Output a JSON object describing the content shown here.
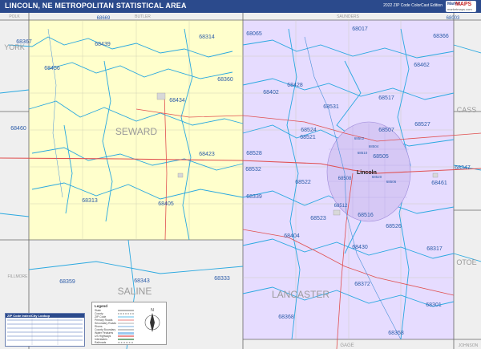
{
  "title": "LINCOLN, NE METROPOLITAN STATISTICAL AREA",
  "edition": "2022 ZIP Code ColorCast Edition",
  "logo": {
    "line1": "Market",
    "line2": "MAPS",
    "line3": "marketmaps.com"
  },
  "colors": {
    "title_bar": "#2b4a8c",
    "seward_fill": "#ffffcc",
    "lancaster_fill": "#e6dcff",
    "outside_fill": "#efefef",
    "zip_boundary": "#2aa8e0",
    "zip_label": "#2b5ba8",
    "county_label": "#9a9a9a",
    "highway": "#e05050"
  },
  "counties": [
    {
      "name": "SEWARD",
      "label": "SEWARD"
    },
    {
      "name": "LANCASTER",
      "label": "LANCASTER"
    },
    {
      "name": "SALINE",
      "label": "SALINE"
    },
    {
      "name": "YORK",
      "label": "YORK"
    },
    {
      "name": "CASS",
      "label": "CASS"
    },
    {
      "name": "OTOE",
      "label": "OTOE"
    },
    {
      "name": "POLK",
      "label": "POLK"
    },
    {
      "name": "BUTLER",
      "label": "BUTLER"
    },
    {
      "name": "SAUNDERS",
      "label": "SAUNDERS"
    },
    {
      "name": "GAGE",
      "label": "GAGE"
    },
    {
      "name": "FILLMORE",
      "label": "FILLMORE"
    },
    {
      "name": "JOHNSON",
      "label": "JOHNSON"
    }
  ],
  "city_labels": [
    {
      "name": "Lincoln",
      "label": "Lincoln"
    }
  ],
  "zip_labels": [
    "68669",
    "68003",
    "68367",
    "68314",
    "68065",
    "68017",
    "68366",
    "68439",
    "68456",
    "68462",
    "68360",
    "68428",
    "68402",
    "68517",
    "68434",
    "68531",
    "68460",
    "68524",
    "68507",
    "68521",
    "68527",
    "68423",
    "68528",
    "68505",
    "68532",
    "68347",
    "68522",
    "68461",
    "68339",
    "68313",
    "68523",
    "68516",
    "68405",
    "68526",
    "68404",
    "68430",
    "68317",
    "68359",
    "68343",
    "68333",
    "68372",
    "68368",
    "68301",
    "68358",
    "68520",
    "68502",
    "68504",
    "68510",
    "68506",
    "68512",
    "68508"
  ],
  "legend": {
    "title": "Legend",
    "items": [
      "State",
      "County",
      "ZIP Code",
      "Primary Roads",
      "Secondary Roads",
      "Rivers",
      "County Boundary",
      "Water Features",
      "US Highways",
      "Interstates",
      "Railroads"
    ]
  },
  "compass": {
    "label": "N"
  },
  "zip_table": {
    "title": "ZIP Code Index/City Lookup"
  }
}
